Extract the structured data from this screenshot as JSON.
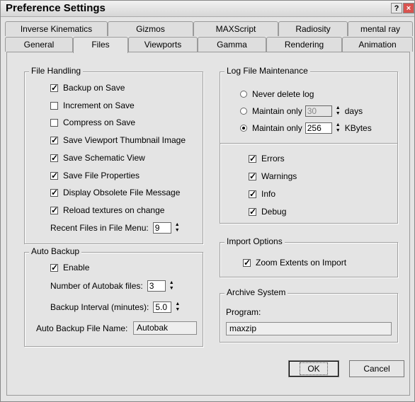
{
  "window": {
    "title": "Preference Settings",
    "help_label": "?",
    "close_label": "×"
  },
  "tabs_row1": [
    "Inverse Kinematics",
    "Gizmos",
    "MAXScript",
    "Radiosity",
    "mental ray"
  ],
  "tabs_row2": [
    "General",
    "Files",
    "Viewports",
    "Gamma",
    "Rendering",
    "Animation"
  ],
  "active_tab": "Files",
  "file_handling": {
    "label": "File Handling",
    "options": [
      {
        "label": "Backup on Save",
        "checked": true
      },
      {
        "label": "Increment on Save",
        "checked": false
      },
      {
        "label": "Compress on Save",
        "checked": false
      },
      {
        "label": "Save Viewport Thumbnail Image",
        "checked": true
      },
      {
        "label": "Save Schematic View",
        "checked": true
      },
      {
        "label": "Save File Properties",
        "checked": true
      },
      {
        "label": "Display Obsolete File Message",
        "checked": true
      },
      {
        "label": "Reload textures on change",
        "checked": true
      }
    ],
    "recent_label": "Recent Files in File Menu:",
    "recent_value": "9"
  },
  "auto_backup": {
    "label": "Auto Backup",
    "enable_label": "Enable",
    "enable_checked": true,
    "num_files_label": "Number of Autobak files:",
    "num_files_value": "3",
    "interval_label": "Backup Interval (minutes):",
    "interval_value": "5.0",
    "filename_label": "Auto Backup File Name:",
    "filename_value": "Autobak"
  },
  "log_file": {
    "label": "Log File Maintenance",
    "never_label": "Never delete log",
    "maintain_label": "Maintain only",
    "days_value": "30",
    "days_unit": "days",
    "kb_value": "256",
    "kb_unit": "KBytes",
    "selected": "kbytes",
    "checks": [
      {
        "label": "Errors",
        "checked": true
      },
      {
        "label": "Warnings",
        "checked": true
      },
      {
        "label": "Info",
        "checked": true
      },
      {
        "label": "Debug",
        "checked": true
      }
    ]
  },
  "import_options": {
    "label": "Import Options",
    "zoom_label": "Zoom Extents on Import",
    "zoom_checked": true
  },
  "archive": {
    "label": "Archive System",
    "program_label": "Program:",
    "program_value": "maxzip"
  },
  "buttons": {
    "ok": "OK",
    "cancel": "Cancel"
  }
}
